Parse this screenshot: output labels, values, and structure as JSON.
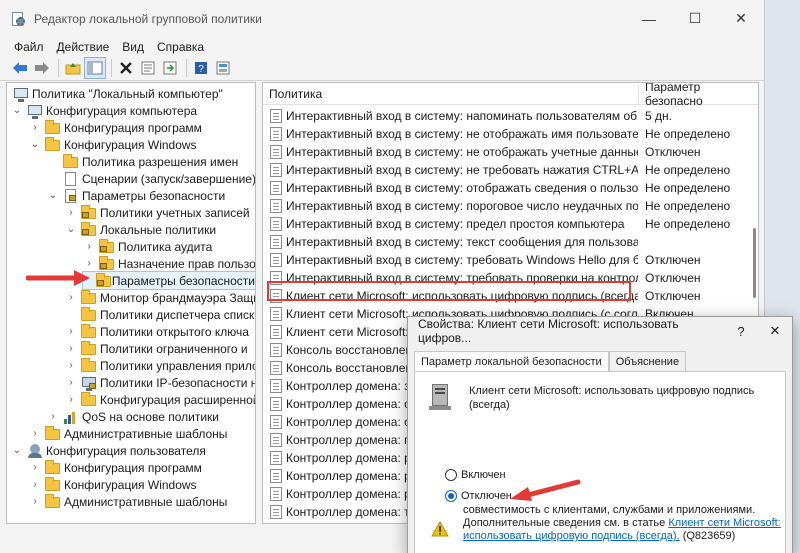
{
  "window": {
    "title": "Редактор локальной групповой политики",
    "minimize": "—",
    "maximize": "☐",
    "close": "✕"
  },
  "menu": [
    "Файл",
    "Действие",
    "Вид",
    "Справка"
  ],
  "toolbar": {
    "icons": [
      "back-icon",
      "forward-icon",
      "up-folder-icon",
      "show-tree-icon",
      "delete-icon",
      "properties-icon",
      "export-icon",
      "help-icon",
      "view-icon"
    ]
  },
  "tree": {
    "items": [
      {
        "label": "Политика \"Локальный компьютер\"",
        "icon": "computer-icon"
      },
      {
        "label": "Конфигурация компьютера",
        "icon": "computer-icon"
      },
      {
        "label": "Конфигурация программ",
        "icon": "folder-icon"
      },
      {
        "label": "Конфигурация Windows",
        "icon": "folder-icon"
      },
      {
        "label": "Политика разрешения имен",
        "icon": "folder-icon"
      },
      {
        "label": "Сценарии (запуск/завершение)",
        "icon": "script-icon"
      },
      {
        "label": "Параметры безопасности",
        "icon": "security-icon"
      },
      {
        "label": "Политики учетных записей",
        "icon": "folder-lock-icon"
      },
      {
        "label": "Локальные политики",
        "icon": "folder-lock-icon"
      },
      {
        "label": "Политика аудита",
        "icon": "folder-lock-icon"
      },
      {
        "label": "Назначение прав пользов",
        "icon": "folder-lock-icon"
      },
      {
        "label": "Параметры безопасности",
        "icon": "folder-lock-icon"
      },
      {
        "label": "Монитор брандмауэра Защи",
        "icon": "folder-icon"
      },
      {
        "label": "Политики диспетчера списка",
        "icon": "folder-icon"
      },
      {
        "label": "Политики открытого ключа",
        "icon": "folder-icon"
      },
      {
        "label": "Политики ограниченного и",
        "icon": "folder-icon"
      },
      {
        "label": "Политики управления прило",
        "icon": "folder-icon"
      },
      {
        "label": "Политики IP-безопасности н",
        "icon": "ipsec-icon"
      },
      {
        "label": "Конфигурация расширенной",
        "icon": "folder-icon"
      },
      {
        "label": "QoS на основе политики",
        "icon": "chart-icon"
      },
      {
        "label": "Административные шаблоны",
        "icon": "folder-icon"
      },
      {
        "label": "Конфигурация пользователя",
        "icon": "user-icon"
      },
      {
        "label": "Конфигурация программ",
        "icon": "folder-icon"
      },
      {
        "label": "Конфигурация Windows",
        "icon": "folder-icon"
      },
      {
        "label": "Административные шаблоны",
        "icon": "folder-icon"
      }
    ]
  },
  "list": {
    "columns": [
      "Политика",
      "Параметр безопасно"
    ],
    "rows": [
      {
        "policy": "Интерактивный вход в систему: напоминать пользователям об ист...",
        "setting": "5 дн."
      },
      {
        "policy": "Интерактивный вход в систему: не отображать имя пользователя п...",
        "setting": "Не определено"
      },
      {
        "policy": "Интерактивный вход в систему: не отображать учетные данные по...",
        "setting": "Отключен"
      },
      {
        "policy": "Интерактивный вход в систему: не требовать нажатия CTRL+ALT+...",
        "setting": "Не определено"
      },
      {
        "policy": "Интерактивный вход в систему: отображать сведения о пользовате...",
        "setting": "Не определено"
      },
      {
        "policy": "Интерактивный вход в систему: пороговое число неудачных попы...",
        "setting": "Не определено"
      },
      {
        "policy": "Интерактивный вход в систему: предел простоя компьютера",
        "setting": "Не определено"
      },
      {
        "policy": "Интерактивный вход в систему: текст сообщения для пользовател...",
        "setting": ""
      },
      {
        "policy": "Интерактивный вход в систему: требовать Windows Hello для бизн...",
        "setting": "Отключен"
      },
      {
        "policy": "Интерактивный вход в систему: требовать проверки на контролле...",
        "setting": "Отключен"
      },
      {
        "policy": "Клиент сети Microsoft: использовать цифровую подпись (всегда)",
        "setting": "Отключен"
      },
      {
        "policy": "Клиент сети Microsoft: использовать цифровую подпись (с соглас...",
        "setting": "Включен"
      },
      {
        "policy": "Клиент сети Microsoft: от",
        "setting": ""
      },
      {
        "policy": "Консоль восстановлени",
        "setting": ""
      },
      {
        "policy": "Консоль восстановлени",
        "setting": ""
      },
      {
        "policy": "Контроллер домена: зап",
        "setting": ""
      },
      {
        "policy": "Контроллер домена: отк",
        "setting": ""
      },
      {
        "policy": "Контроллер домена: отк",
        "setting": ""
      },
      {
        "policy": "Контроллер домена: при",
        "setting": ""
      },
      {
        "policy": "Контроллер домена: раз",
        "setting": ""
      },
      {
        "policy": "Контроллер домена: раз",
        "setting": ""
      },
      {
        "policy": "Контроллер домена: раз",
        "setting": ""
      },
      {
        "policy": "Контроллер домена: тре",
        "setting": ""
      },
      {
        "policy": "Контроллер домена: тре",
        "setting": ""
      }
    ]
  },
  "dialog": {
    "title": "Свойства: Клиент сети Microsoft: использовать цифров...",
    "help": "?",
    "close": "✕",
    "tabs": [
      "Параметр локальной безопасности",
      "Объяснение"
    ],
    "description": "Клиент сети Microsoft: использовать цифровую подпись (всегда)",
    "radio_enabled": "Включен",
    "radio_disabled": "Отключен",
    "selected": "Отключен",
    "warning_line1": "совместимость с клиентами, службами и приложениями.",
    "warning_line2": "Дополнительные сведения см. в статье",
    "warning_link": "Клиент сети Microsoft: использовать цифровую подпись (всегда).",
    "warning_ref": "(Q823659)"
  },
  "colors": {
    "highlight_box": "#e53935",
    "arrow": "#e53935",
    "link": "#0066cc"
  }
}
